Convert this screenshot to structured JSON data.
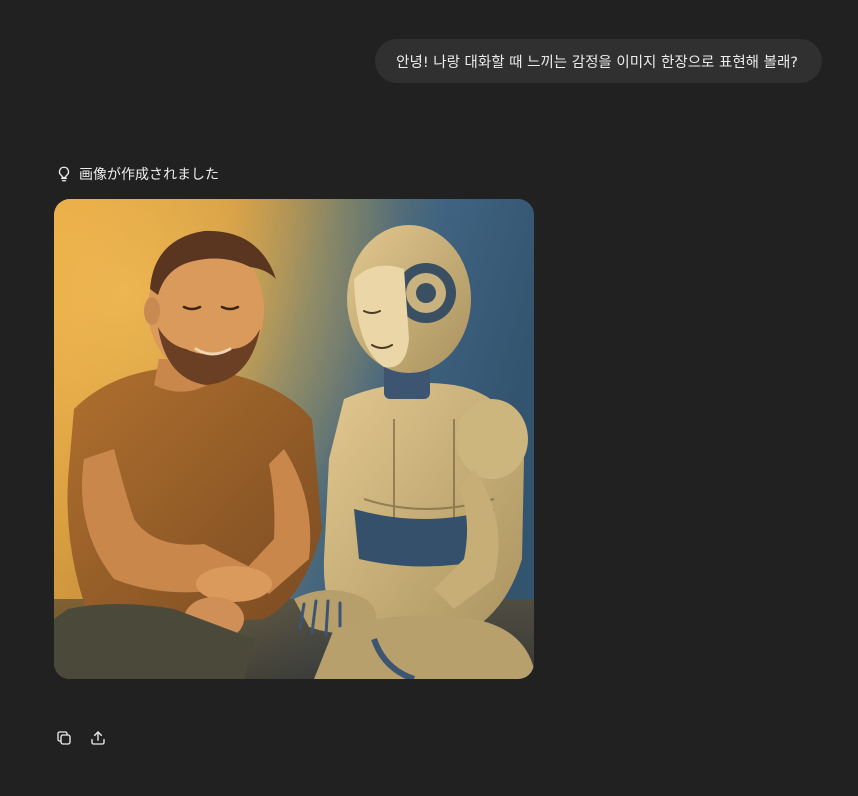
{
  "conversation": {
    "user_message": "안녕! 나랑 대화할 때 느끼는 감정을 이미지 한장으로 표현해 볼래?",
    "assistant": {
      "status_text": "画像が作成されました",
      "status_icon": "lightbulb-icon",
      "image": {
        "subject": "warm painted scene: smiling bearded man sitting beside a gentle humanoid robot"
      },
      "actions": [
        {
          "icon": "copy-icon"
        },
        {
          "icon": "share-upload-icon"
        }
      ]
    }
  },
  "colors": {
    "background": "#212121",
    "bubble": "#303030",
    "text": "#ececec"
  }
}
